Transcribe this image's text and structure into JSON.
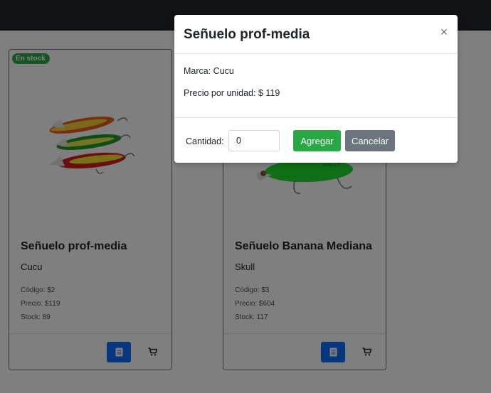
{
  "products": [
    {
      "badge": "En stock",
      "title": "Señuelo prof-media",
      "brand": "Cucu",
      "code": "Código: $2",
      "price": "Precio: $119",
      "stock": "Stock: 89",
      "image_icon": "lure-image"
    },
    {
      "badge": "",
      "title": "Señuelo Banana Mediana",
      "brand": "Skull",
      "code": "Código: $3",
      "price": "Precio: $604",
      "stock": "Stock: 117",
      "image_icon": "lure-image"
    }
  ],
  "modal": {
    "title": "Señuelo prof-media",
    "close_icon": "close-icon",
    "brand_line": "Marca: Cucu",
    "price_line": "Precio por unidad: $ 119",
    "quantity_label": "Cantidad:",
    "quantity_value": "0",
    "add_label": "Agregar",
    "cancel_label": "Cancelar"
  },
  "colors": {
    "navbar": "#212529",
    "success": "#28a745",
    "primary": "#0d6efd",
    "secondary": "#6c757d",
    "backdrop": "rgba(0,0,0,0.5)"
  }
}
